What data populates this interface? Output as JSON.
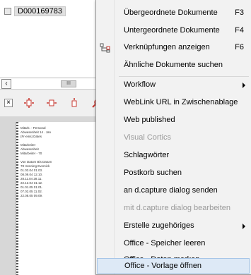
{
  "window": {
    "title": "D000169783"
  },
  "viewer": {
    "scroll_label": "III",
    "doc_lines": [
      "Mitarb. - Personal",
      "Abwesenheit          14 . Jan",
      "(Fr-eins)       Dates",
      "",
      "Mitarbeiter",
      "Abwesenheit",
      "Mitarbeiter - 70",
      "",
      "Von Datum        Bis Datum",
      "                 78 Henning Eversick",
      "01.03.04        01.03.",
      "08.09.04        12.10.",
      "28.11.04        28.11.",
      "22.12.04        31.12.",
      "01.01.05        01.01.",
      "07.02.05        11.02.",
      "22.08.05        09.09."
    ]
  },
  "menu": {
    "items": [
      {
        "label": "Übergeordnete Dokumente",
        "shortcut": "F3"
      },
      {
        "label": "Untergeordnete Dokumente",
        "shortcut": "F4"
      },
      {
        "label": "Verknüpfungen anzeigen",
        "shortcut": "F6",
        "icon": "link-tree-icon"
      },
      {
        "label": "Ähnliche Dokumente suchen"
      },
      {
        "label": "Workflow",
        "submenu": true
      },
      {
        "label": "WebLink URL in Zwischenablage"
      },
      {
        "label": "Web published"
      },
      {
        "label": "Visual Cortics",
        "disabled": true
      },
      {
        "label": "Schlagwörter"
      },
      {
        "label": "Postkorb suchen"
      },
      {
        "label": "an d.capture dialog senden"
      },
      {
        "label": "mit d.capture dialog bearbeiten",
        "disabled": true
      },
      {
        "label": "Erstelle zugehöriges",
        "submenu": true
      },
      {
        "label": "Office - Speicher leeren"
      },
      {
        "label": "Office - Daten merken"
      },
      {
        "label": "Office - Vorlage öffnen",
        "hover": true
      }
    ]
  },
  "colors": {
    "accent": "#c7372f",
    "hover_bg": "#dde9f6",
    "hover_border": "#a7c6e8"
  }
}
